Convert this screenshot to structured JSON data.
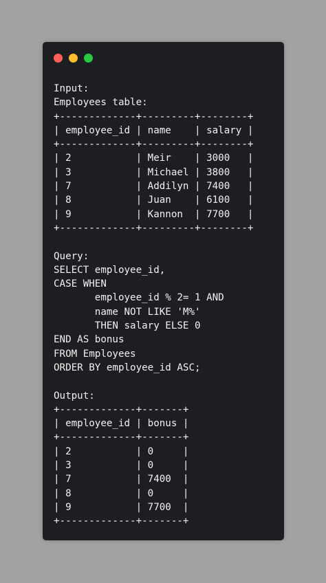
{
  "window": {
    "controls": [
      {
        "name": "close",
        "color": "#ff5f57"
      },
      {
        "name": "minimize",
        "color": "#febc2e"
      },
      {
        "name": "maximize",
        "color": "#28c840"
      }
    ],
    "lines": [
      "Input:",
      "Employees table:",
      "+-------------+---------+--------+",
      "| employee_id | name    | salary |",
      "+-------------+---------+--------+",
      "| 2           | Meir    | 3000   |",
      "| 3           | Michael | 3800   |",
      "| 7           | Addilyn | 7400   |",
      "| 8           | Juan    | 6100   |",
      "| 9           | Kannon  | 7700   |",
      "+-------------+---------+--------+",
      "",
      "Query:",
      "SELECT employee_id,",
      "CASE WHEN",
      "       employee_id % 2= 1 AND",
      "       name NOT LIKE 'M%'",
      "       THEN salary ELSE 0",
      "END AS bonus",
      "FROM Employees",
      "ORDER BY employee_id ASC;",
      "",
      "Output:",
      "+-------------+-------+",
      "| employee_id | bonus |",
      "+-------------+-------+",
      "| 2           | 0     |",
      "| 3           | 0     |",
      "| 7           | 7400  |",
      "| 8           | 0     |",
      "| 9           | 7700  |",
      "+-------------+-------+"
    ]
  }
}
